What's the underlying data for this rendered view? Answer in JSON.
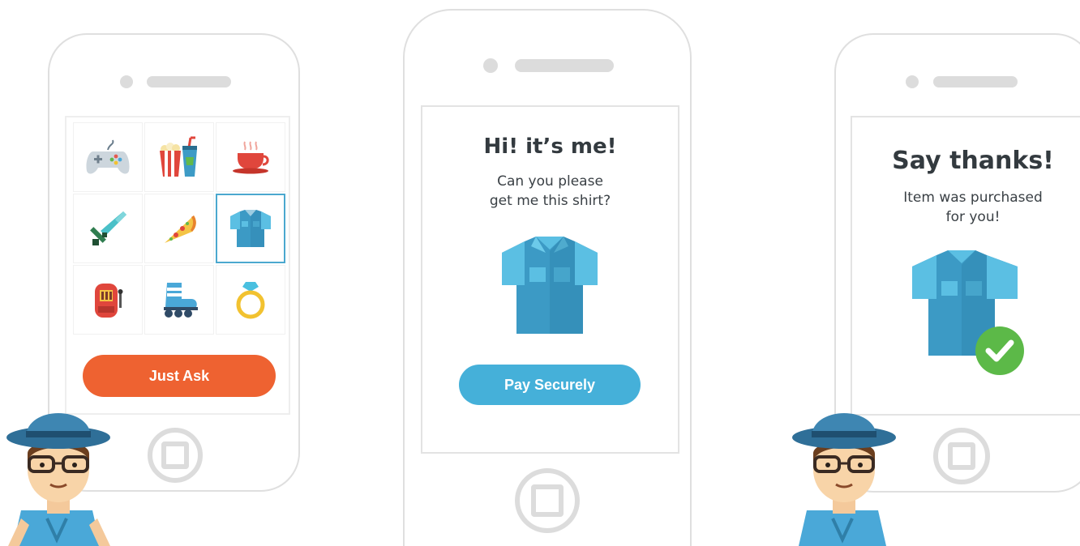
{
  "colors": {
    "orange": "#ee6231",
    "blue": "#45b0d9",
    "shirt": "#3c9ac5",
    "shirt_light": "#5bbfe3",
    "check": "#5cb948",
    "text": "#333a3f"
  },
  "screen1": {
    "items": [
      {
        "icon": "game-controller-icon"
      },
      {
        "icon": "popcorn-drink-icon"
      },
      {
        "icon": "coffee-cup-icon"
      },
      {
        "icon": "pixel-sword-icon"
      },
      {
        "icon": "pizza-slice-icon"
      },
      {
        "icon": "shirt-icon",
        "selected": true
      },
      {
        "icon": "slot-machine-icon"
      },
      {
        "icon": "roller-skate-icon"
      },
      {
        "icon": "ring-icon"
      }
    ],
    "ask_button": "Just Ask"
  },
  "screen2": {
    "title": "Hi! it’s me!",
    "message": "Can you please\nget me this shirt?",
    "pay_button": "Pay Securely"
  },
  "screen3": {
    "title": "Say thanks!",
    "message": "Item was purchased\nfor you!"
  }
}
